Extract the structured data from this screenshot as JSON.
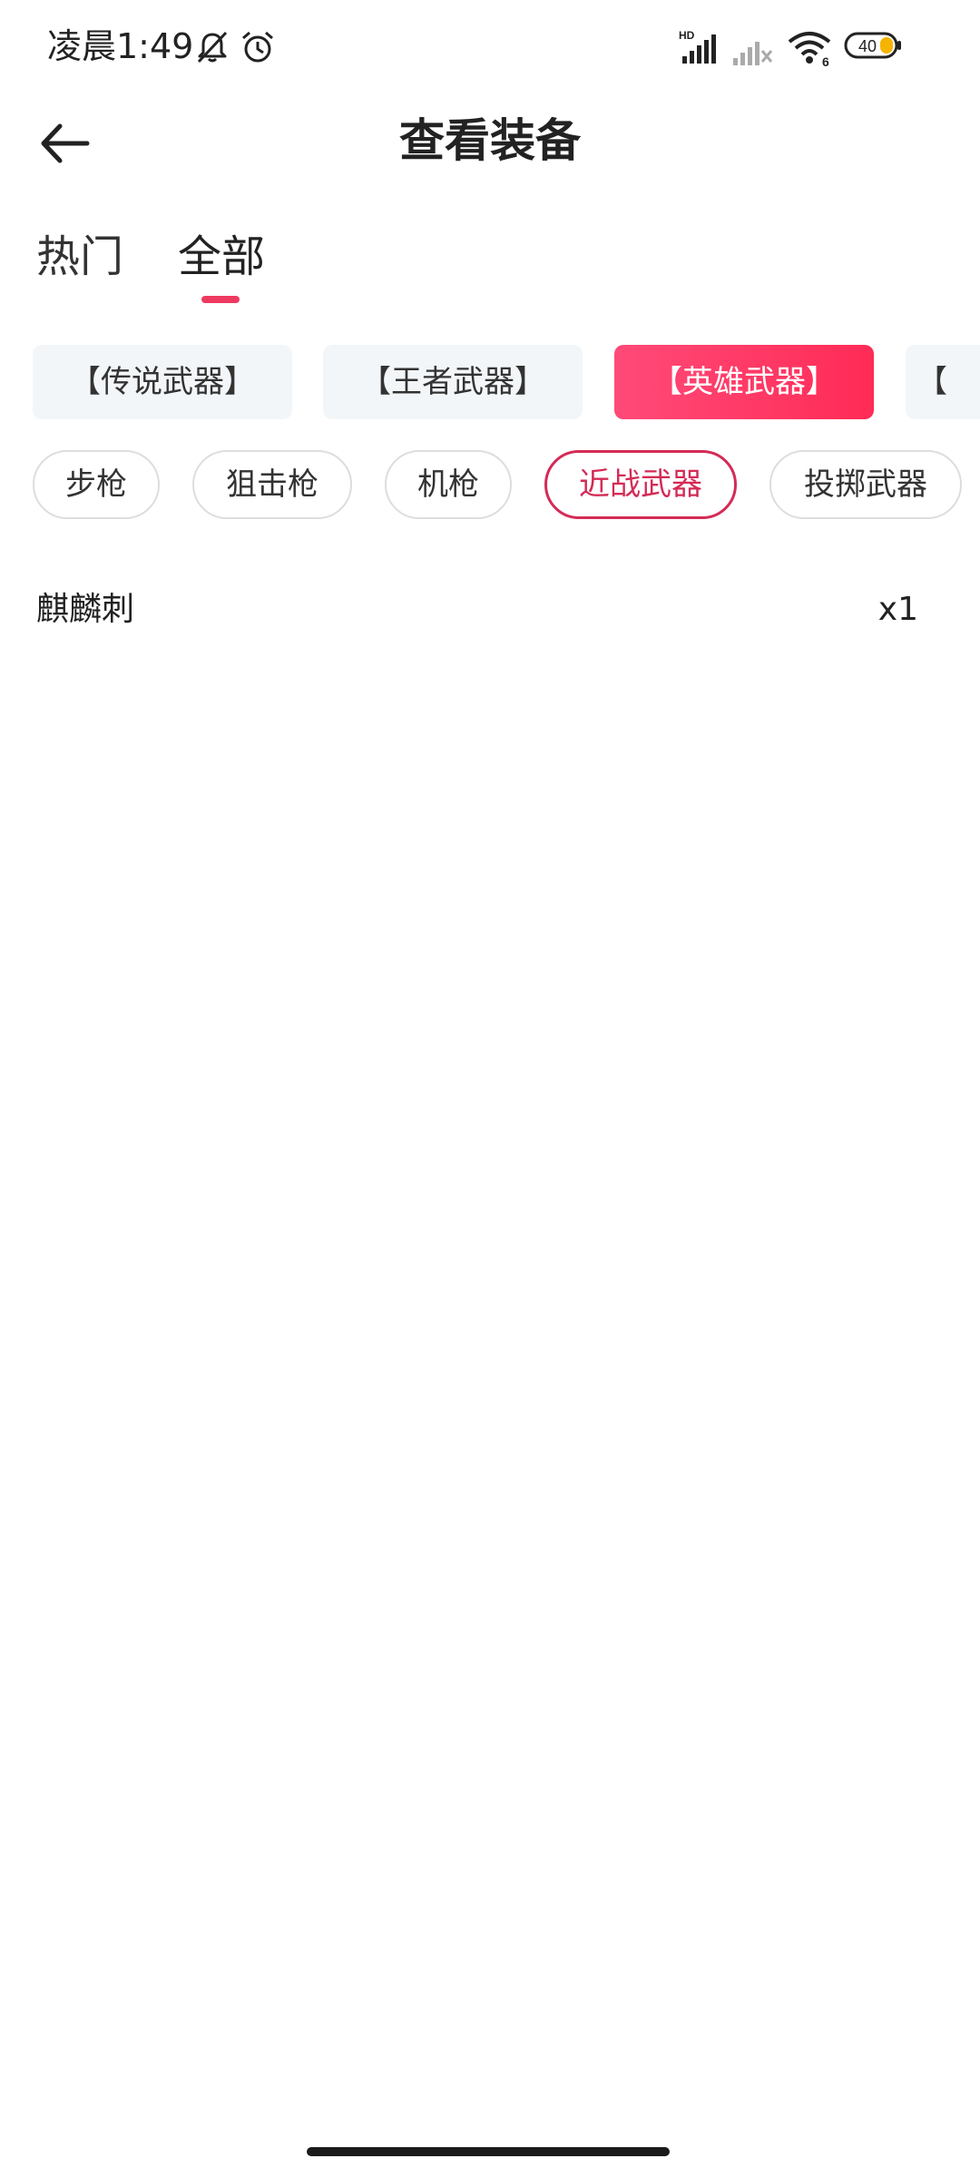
{
  "status_bar": {
    "time": "凌晨1:49",
    "network_badge": "HD",
    "battery_level": "40",
    "icons": [
      "bell-muted-icon",
      "alarm-clock-icon",
      "signal-bars-icon",
      "signal-bars-no-service-icon",
      "wifi-icon",
      "battery-icon"
    ]
  },
  "header": {
    "title": "查看装备",
    "back_icon": "arrow-left-icon"
  },
  "main_tabs": [
    {
      "label": "热门",
      "active": false
    },
    {
      "label": "全部",
      "active": true
    }
  ],
  "categories": [
    {
      "label": "【传说武器】",
      "active": false
    },
    {
      "label": "【王者武器】",
      "active": false
    },
    {
      "label": "【英雄武器】",
      "active": true
    },
    {
      "label": "【",
      "active": false
    }
  ],
  "filters": [
    {
      "label": "步枪",
      "active": false
    },
    {
      "label": "狙击枪",
      "active": false
    },
    {
      "label": "机枪",
      "active": false
    },
    {
      "label": "近战武器",
      "active": true
    },
    {
      "label": "投掷武器",
      "active": false
    }
  ],
  "items": [
    {
      "name": "麒麟刺",
      "count": "x1"
    }
  ],
  "colors": {
    "accent": "#ee3a60",
    "active_chip_start": "#ff4a78",
    "active_chip_end": "#ff2b56",
    "active_pill_border": "#d42b56",
    "chip_background": "#f3f6f8",
    "battery_fill": "#f5b400"
  }
}
